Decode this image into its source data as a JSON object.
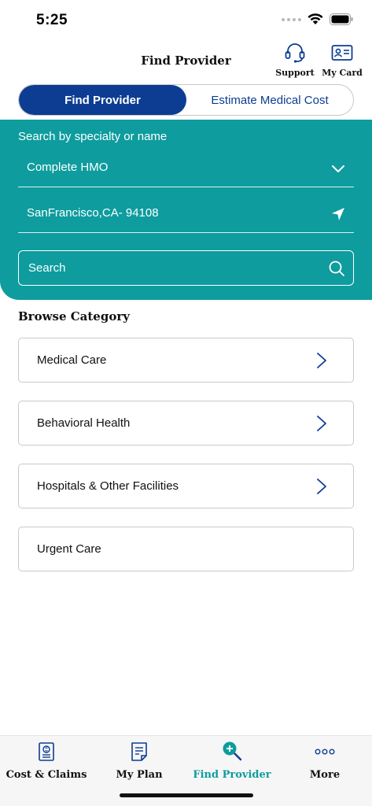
{
  "status_bar": {
    "time": "5:25"
  },
  "header": {
    "title": "Find Provider",
    "support_label": "Support",
    "card_label": "My Card"
  },
  "tabs": [
    {
      "label": "Find Provider",
      "active": true
    },
    {
      "label": "Estimate Medical Cost",
      "active": false
    }
  ],
  "search": {
    "label": "Search by specialty or name",
    "plan_value": "Complete HMO",
    "location_value": "SanFrancisco,CA- 94108",
    "placeholder": "Search"
  },
  "browse": {
    "title": "Browse Category",
    "items": [
      {
        "label": "Medical Care",
        "has_chevron": true
      },
      {
        "label": "Behavioral Health",
        "has_chevron": true
      },
      {
        "label": "Hospitals & Other Facilities",
        "has_chevron": true
      },
      {
        "label": "Urgent Care",
        "has_chevron": false
      }
    ]
  },
  "bottom_nav": [
    {
      "label": "Cost & Claims",
      "icon": "claims-icon",
      "active": false
    },
    {
      "label": "My Plan",
      "icon": "document-icon",
      "active": false
    },
    {
      "label": "Find Provider",
      "icon": "find-provider-icon",
      "active": true
    },
    {
      "label": "More",
      "icon": "more-icon",
      "active": false
    }
  ],
  "colors": {
    "primary_blue": "#0c3d93",
    "teal": "#0e9c9e",
    "white": "#ffffff"
  }
}
